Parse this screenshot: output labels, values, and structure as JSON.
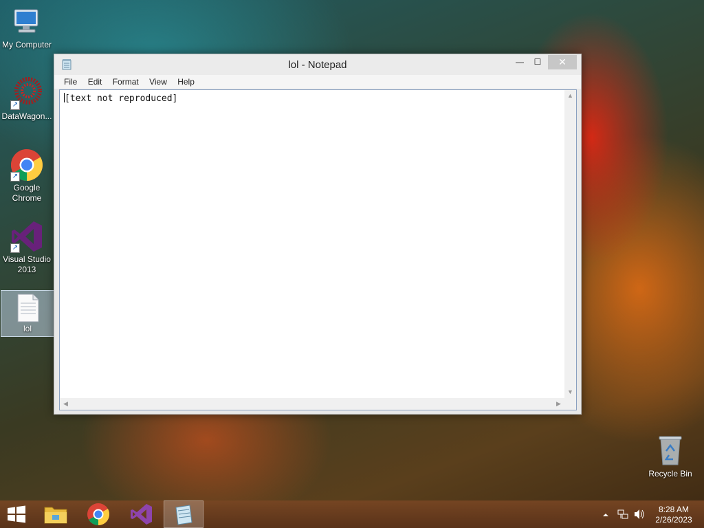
{
  "desktop": {
    "icons": [
      {
        "label": "My Computer"
      },
      {
        "label": "DataWagon..."
      },
      {
        "label": "Google Chrome"
      },
      {
        "label": "Visual Studio 2013"
      },
      {
        "label": "lol"
      },
      {
        "label": "Recycle Bin"
      }
    ]
  },
  "notepad": {
    "title": "lol - Notepad",
    "window_buttons": {
      "minimize": "—",
      "maximize": "☐",
      "close": "✕"
    },
    "menu": [
      "File",
      "Edit",
      "Format",
      "View",
      "Help"
    ],
    "content": "[text not reproduced]"
  },
  "taskbar": {
    "apps": [
      {
        "icon": "windows-start-icon"
      },
      {
        "icon": "file-explorer-icon"
      },
      {
        "icon": "chrome-icon"
      },
      {
        "icon": "visual-studio-icon"
      },
      {
        "icon": "notepad-icon",
        "active": true
      }
    ],
    "clock": {
      "time": "8:28 AM",
      "date": "2/26/2023"
    }
  },
  "colors": {
    "accent": "#0078d7",
    "vs_purple": "#68217a",
    "taskbar": "#6e4020"
  }
}
